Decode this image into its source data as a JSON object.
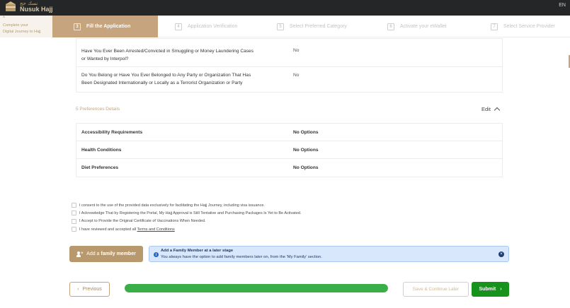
{
  "header": {
    "logo_ar": "نسك حج",
    "logo_en": "Nusuk Hajj",
    "lang": "EN"
  },
  "sidebar": {
    "toggle_line1": "Complete your",
    "toggle_line2": "Digital Journey to Hajj"
  },
  "steps": [
    {
      "num": "3",
      "label": "Fill the Application",
      "active": true
    },
    {
      "num": "4",
      "label": "Application Verification",
      "active": false
    },
    {
      "num": "5",
      "label": "Select Preferred Category",
      "active": false
    },
    {
      "num": "6",
      "label": "Activate your eWallet",
      "active": false
    },
    {
      "num": "7",
      "label": "Select Service Provider",
      "active": false
    }
  ],
  "security_questions": [
    {
      "question_line1": "Have You Ever Been Arrested/Convicted in Smuggling or Money Laundering Cases",
      "question_line2": "or Wanted by Interpol?",
      "answer": "No"
    },
    {
      "question_line1": "Do You Belong or Have You Ever Belonged to Any Party or Organization That Has",
      "question_line2": "Been Designated Internationally or Locally as a Terrorist Organization or Party",
      "answer": "No"
    }
  ],
  "preferences": {
    "title": "5 Preferences Details",
    "edit_label": "Edit",
    "rows": [
      {
        "label": "Accessibility Requirements",
        "value": "No Options"
      },
      {
        "label": "Health Conditions",
        "value": "No Options"
      },
      {
        "label": "Diet Preferences",
        "value": "No Options"
      }
    ]
  },
  "consents": [
    "I consent to the use of the provided data exclusively for facilitating the Hajj Journey, including visa issuance.",
    "I Acknowledge That by Registering the Portal, My Hajj Approval is Still Tentative and Purchasing Packages Is Yet to Be Activated.",
    "I Accept to Provide the Original Certificate of Vaccinations When Needed."
  ],
  "terms_consent": {
    "prefix": "I have reviewed and accepted all ",
    "link": "Terms and Conditions"
  },
  "family": {
    "button_prefix": "Add a ",
    "button_bold": "family member",
    "notice_title": "Add a Family Member at a later stage",
    "notice_text": "You always have the option to add family members later on, from the 'My Family' section."
  },
  "footer": {
    "previous_label": "Previous",
    "save_label": "Save & Continue Later",
    "submit_label": "Submit",
    "progress_fraction": 1.0
  },
  "colors": {
    "gold": "#c5a47e",
    "green": "#16921d",
    "progress": "#3aae48",
    "info_bg": "#d8e7fb"
  },
  "icons": [
    "nusuk-logo-icon",
    "chevron-up-icon",
    "info-icon",
    "close-icon",
    "add-person-icon",
    "chevron-left-icon",
    "chevron-right-icon"
  ]
}
